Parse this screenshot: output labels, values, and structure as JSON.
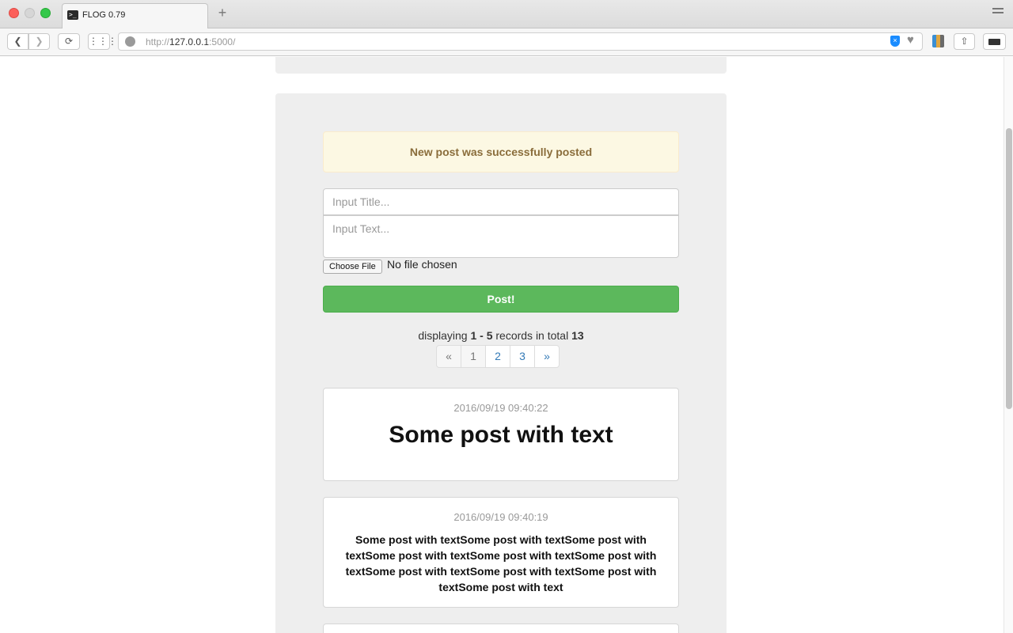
{
  "browser": {
    "tab_title": "FLOG 0.79",
    "new_tab_symbol": "+",
    "url_prefix": "http://",
    "url_host": "127.0.0.1",
    "url_suffix": ":5000/"
  },
  "alert": {
    "message": "New post was successfully posted"
  },
  "form": {
    "title_placeholder": "Input Title...",
    "text_placeholder": "Input Text...",
    "file_button": "Choose File",
    "file_status": "No file chosen",
    "submit_label": "Post!"
  },
  "records": {
    "prefix": "displaying",
    "range": "1 - 5",
    "middle": "records in total",
    "total": "13"
  },
  "pagination": {
    "prev": "«",
    "pages": [
      "1",
      "2",
      "3"
    ],
    "next": "»",
    "current": "1"
  },
  "posts": [
    {
      "date": "2016/09/19 09:40:22",
      "heading": "Some post with text"
    },
    {
      "date": "2016/09/19 09:40:19",
      "body": "Some post with textSome post with textSome post with textSome post with textSome post with textSome post with textSome post with textSome post with textSome post with textSome post with text"
    }
  ],
  "colors": {
    "success": "#5cb85c",
    "alert_bg": "#fcf8e3",
    "alert_text": "#8a6d3b",
    "link": "#337ab7",
    "card_bg": "#eeeeee"
  }
}
